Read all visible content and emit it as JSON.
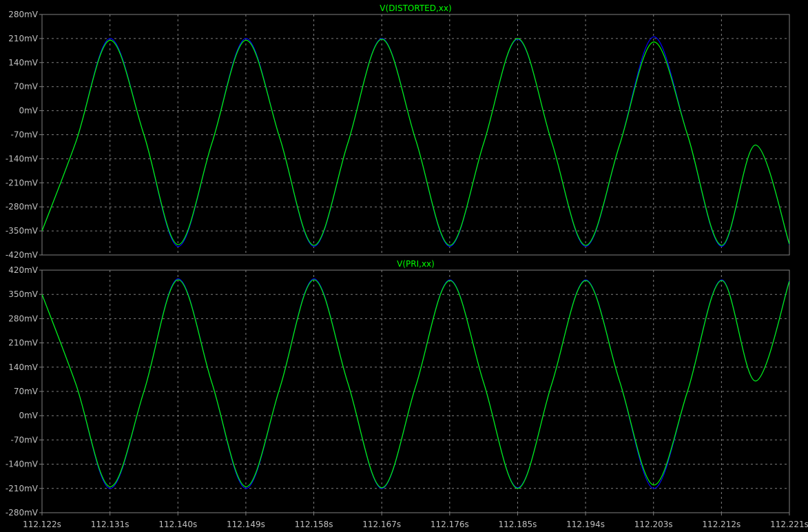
{
  "chart_data": [
    {
      "type": "line",
      "title": "V(DISTORTED,xx)",
      "xlabel": "",
      "ylabel": "",
      "xlim": [
        112.122,
        112.221
      ],
      "ylim": [
        -420,
        280
      ],
      "x_unit": "s",
      "y_unit": "mV",
      "grid": true,
      "x_ticks": [
        "112.122s",
        "112.131s",
        "112.140s",
        "112.149s",
        "112.158s",
        "112.167s",
        "112.176s",
        "112.185s",
        "112.194s",
        "112.203s",
        "112.212s",
        "112.221s"
      ],
      "y_ticks": [
        "280mV",
        "210mV",
        "140mV",
        "70mV",
        "0mV",
        "-70mV",
        "-140mV",
        "-210mV",
        "-280mV",
        "-350mV",
        "-420mV"
      ],
      "series": [
        {
          "color": "#0000ff",
          "x": [
            112.122,
            112.1265,
            112.131,
            112.1355,
            112.14,
            112.1445,
            112.149,
            112.1535,
            112.158,
            112.1625,
            112.167,
            112.1715,
            112.176,
            112.1805,
            112.185,
            112.1895,
            112.194,
            112.1985,
            112.203,
            112.2075,
            112.212,
            112.2165,
            112.221
          ],
          "y": [
            -350,
            -90,
            210,
            -70,
            -395,
            -95,
            210,
            -80,
            -395,
            -95,
            210,
            -85,
            -395,
            -95,
            208,
            -90,
            -395,
            -100,
            215,
            -70,
            -395,
            -100,
            -390
          ]
        },
        {
          "color": "#00ff00",
          "x": [
            112.122,
            112.1265,
            112.131,
            112.1355,
            112.14,
            112.1445,
            112.149,
            112.1535,
            112.158,
            112.1625,
            112.167,
            112.1715,
            112.176,
            112.1805,
            112.185,
            112.1895,
            112.194,
            112.1985,
            112.203,
            112.2075,
            112.212,
            112.2165,
            112.221
          ],
          "y": [
            -350,
            -90,
            205,
            -70,
            -390,
            -95,
            205,
            -80,
            -392,
            -95,
            208,
            -85,
            -392,
            -95,
            210,
            -90,
            -392,
            -100,
            200,
            -70,
            -392,
            -100,
            -388
          ]
        }
      ]
    },
    {
      "type": "line",
      "title": "V(PRI,xx)",
      "xlabel": "",
      "ylabel": "",
      "xlim": [
        112.122,
        112.221
      ],
      "ylim": [
        -280,
        420
      ],
      "x_unit": "s",
      "y_unit": "mV",
      "grid": true,
      "x_ticks": [
        "112.122s",
        "112.131s",
        "112.140s",
        "112.149s",
        "112.158s",
        "112.167s",
        "112.176s",
        "112.185s",
        "112.194s",
        "112.203s",
        "112.212s",
        "112.221s"
      ],
      "y_ticks": [
        "420mV",
        "350mV",
        "280mV",
        "210mV",
        "140mV",
        "70mV",
        "0mV",
        "-70mV",
        "-140mV",
        "-210mV",
        "-280mV"
      ],
      "series": [
        {
          "color": "#0000ff",
          "x": [
            112.122,
            112.1265,
            112.131,
            112.1355,
            112.14,
            112.1445,
            112.149,
            112.1535,
            112.158,
            112.1625,
            112.167,
            112.1715,
            112.176,
            112.1805,
            112.185,
            112.1895,
            112.194,
            112.1985,
            112.203,
            112.2075,
            112.212,
            112.2165,
            112.221
          ],
          "y": [
            350,
            90,
            -210,
            70,
            395,
            95,
            -210,
            80,
            395,
            95,
            -210,
            85,
            392,
            95,
            -208,
            90,
            392,
            100,
            -210,
            70,
            392,
            100,
            390
          ]
        },
        {
          "color": "#00ff00",
          "x": [
            112.122,
            112.1265,
            112.131,
            112.1355,
            112.14,
            112.1445,
            112.149,
            112.1535,
            112.158,
            112.1625,
            112.167,
            112.1715,
            112.176,
            112.1805,
            112.185,
            112.1895,
            112.194,
            112.1985,
            112.203,
            112.2075,
            112.212,
            112.2165,
            112.221
          ],
          "y": [
            350,
            90,
            -205,
            70,
            392,
            95,
            -205,
            80,
            392,
            95,
            -208,
            85,
            390,
            95,
            -210,
            90,
            390,
            100,
            -200,
            70,
            390,
            100,
            388
          ]
        }
      ]
    }
  ]
}
